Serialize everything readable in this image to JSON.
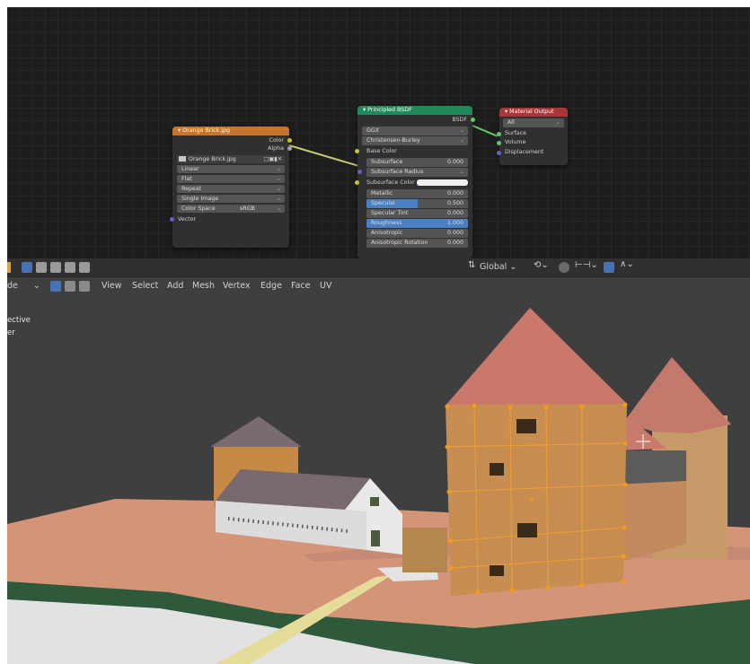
{
  "image_node": {
    "title": "Orange Brick.jpg",
    "outputs": [
      "Color",
      "Alpha"
    ],
    "image_name": "Orange Brick.jpg",
    "interpolation": "Linear",
    "projection": "Flat",
    "extension": "Repeat",
    "source": "Single Image",
    "color_space_label": "Color Space",
    "color_space_value": "sRGB",
    "vector_label": "Vector"
  },
  "bsdf_node": {
    "title": "Principled BSDF",
    "output": "BSDF",
    "distribution": "GGX",
    "subsurface_method": "Christensen-Burley",
    "base_color": "Base Color",
    "subsurface": {
      "label": "Subsurface",
      "value": "0.000"
    },
    "subsurface_radius": "Subsurface Radius",
    "subsurface_color": "Subsurface Color",
    "metallic": {
      "label": "Metallic",
      "value": "0.000"
    },
    "specular": {
      "label": "Specular",
      "value": "0.500",
      "fraction": 0.5
    },
    "specular_tint": {
      "label": "Specular Tint",
      "value": "0.000"
    },
    "roughness": {
      "label": "Roughness",
      "value": "1.000",
      "fraction": 1.0
    },
    "anisotropic": {
      "label": "Anisotropic",
      "value": "0.000"
    },
    "anisotropic_rotation": {
      "label": "Anisotropic Rotation",
      "value": "0.000"
    }
  },
  "output_node": {
    "title": "Material Output",
    "target": "All",
    "inputs": [
      "Surface",
      "Volume",
      "Displacement"
    ]
  },
  "viewport": {
    "mode_partial": "de",
    "menus": [
      "View",
      "Select",
      "Add",
      "Mesh",
      "Vertex",
      "Edge",
      "Face",
      "UV"
    ],
    "transform_orientation": "Global",
    "overlay_line1": "ective",
    "overlay_line2": "er"
  },
  "colors": {
    "image_header": "#c6762c",
    "bsdf_header": "#1f8a5a",
    "output_header": "#a8373a",
    "slider_fill": "#4a7fc1",
    "selection_orange": "#f29b1d"
  }
}
